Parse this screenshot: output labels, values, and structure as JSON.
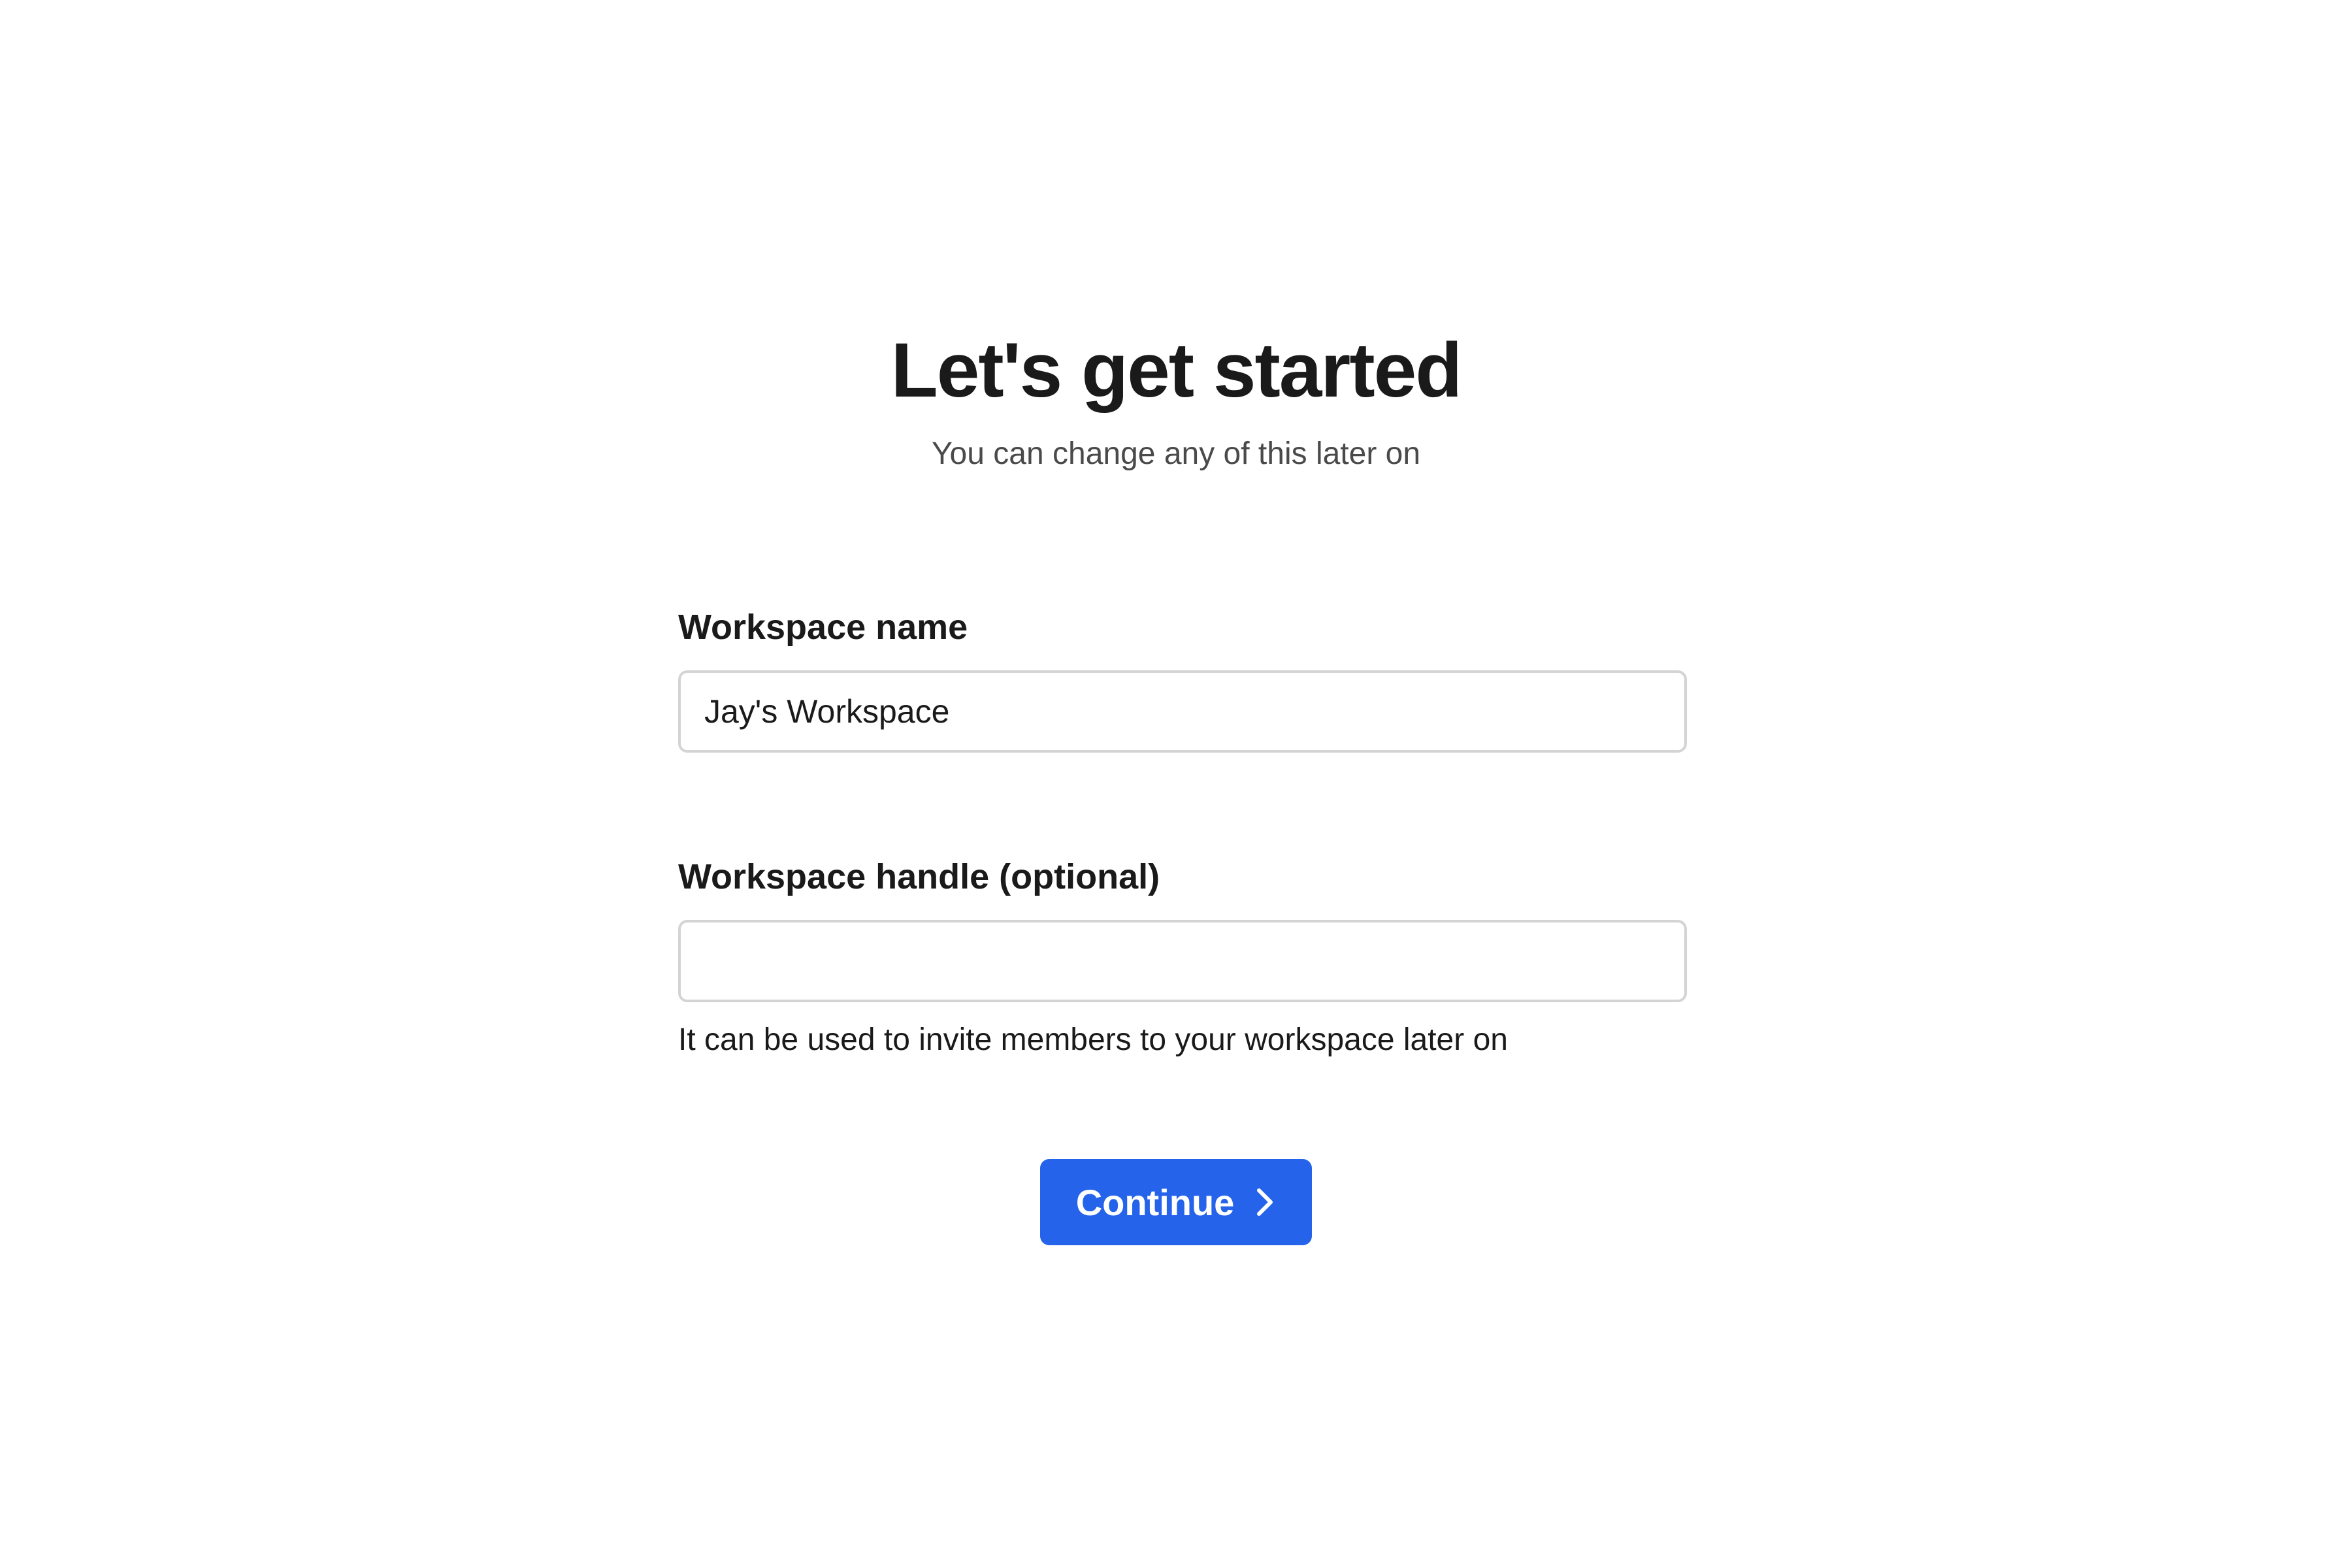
{
  "header": {
    "title": "Let's get started",
    "subtitle": "You can change any of this later on"
  },
  "form": {
    "workspace_name": {
      "label": "Workspace name",
      "value": "Jay's Workspace"
    },
    "workspace_handle": {
      "label": "Workspace handle (optional)",
      "value": "",
      "helper": "It can be used to invite members to your workspace later on"
    }
  },
  "actions": {
    "continue_label": "Continue",
    "continue_icon": "chevron-right-icon"
  },
  "colors": {
    "accent": "#2563eb",
    "text": "#1a1a1a",
    "muted": "#4a4a4a",
    "input_border": "#d4d4d4"
  }
}
